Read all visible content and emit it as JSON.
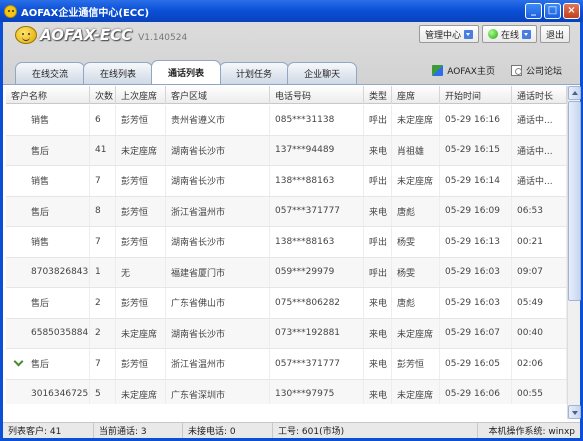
{
  "window": {
    "title": "AOFAX企业通信中心(ECC)",
    "controls": [
      "_",
      "□",
      "×"
    ]
  },
  "brand": {
    "name": "AOFAX-ECC",
    "version": "V1.140524"
  },
  "toolbar": {
    "manage_label": "管理中心",
    "status_label": "在线",
    "logout_label": "退出"
  },
  "tabs": [
    {
      "label": "在线交流",
      "active": false
    },
    {
      "label": "在线列表",
      "active": false
    },
    {
      "label": "通话列表",
      "active": true
    },
    {
      "label": "计划任务",
      "active": false
    },
    {
      "label": "企业聊天",
      "active": false
    }
  ],
  "links": {
    "home_label": "AOFAX主页",
    "forum_label": "公司论坛"
  },
  "table": {
    "columns": [
      "客户名称",
      "次数",
      "上次座席",
      "客户区域",
      "电话号码",
      "类型",
      "座席",
      "开始时间",
      "通话时长"
    ],
    "rows": [
      {
        "name": "销售",
        "count": "6",
        "last_agent": "彭芳恒",
        "region": "贵州省遵义市",
        "phone": "085***31138",
        "type": "呼出",
        "agent": "未定座席",
        "start": "05-29 16:16",
        "duration": "通话中...",
        "icon": ""
      },
      {
        "name": "售后",
        "count": "41",
        "last_agent": "未定座席",
        "region": "湖南省长沙市",
        "phone": "137***94489",
        "type": "来电",
        "agent": "肖祖雄",
        "start": "05-29 16:15",
        "duration": "通话中...",
        "icon": ""
      },
      {
        "name": "销售",
        "count": "7",
        "last_agent": "彭芳恒",
        "region": "湖南省长沙市",
        "phone": "138***88163",
        "type": "呼出",
        "agent": "未定座席",
        "start": "05-29 16:14",
        "duration": "通话中...",
        "icon": ""
      },
      {
        "name": "售后",
        "count": "8",
        "last_agent": "彭芳恒",
        "region": "浙江省温州市",
        "phone": "057***371777",
        "type": "来电",
        "agent": "唐彪",
        "start": "05-29 16:09",
        "duration": "06:53",
        "icon": ""
      },
      {
        "name": "销售",
        "count": "7",
        "last_agent": "彭芳恒",
        "region": "湖南省长沙市",
        "phone": "138***88163",
        "type": "呼出",
        "agent": "杨雯",
        "start": "05-29 16:13",
        "duration": "00:21",
        "icon": ""
      },
      {
        "name": "8703826843",
        "count": "1",
        "last_agent": "无",
        "region": "福建省厦门市",
        "phone": "059***29979",
        "type": "呼出",
        "agent": "杨雯",
        "start": "05-29 16:03",
        "duration": "09:07",
        "icon": ""
      },
      {
        "name": "售后",
        "count": "2",
        "last_agent": "彭芳恒",
        "region": "广东省佛山市",
        "phone": "075***806282",
        "type": "来电",
        "agent": "唐彪",
        "start": "05-29 16:03",
        "duration": "05:49",
        "icon": ""
      },
      {
        "name": "6585035884",
        "count": "2",
        "last_agent": "未定座席",
        "region": "湖南省长沙市",
        "phone": "073***192881",
        "type": "来电",
        "agent": "未定座席",
        "start": "05-29 16:07",
        "duration": "00:40",
        "icon": ""
      },
      {
        "name": "售后",
        "count": "7",
        "last_agent": "彭芳恒",
        "region": "浙江省温州市",
        "phone": "057***371777",
        "type": "来电",
        "agent": "彭芳恒",
        "start": "05-29 16:05",
        "duration": "02:06",
        "icon": "callin"
      },
      {
        "name": "3016346725",
        "count": "5",
        "last_agent": "未定座席",
        "region": "广东省深圳市",
        "phone": "130***97975",
        "type": "来电",
        "agent": "未定座席",
        "start": "05-29 16:06",
        "duration": "00:55",
        "icon": ""
      }
    ]
  },
  "statusbar": {
    "list_count": "列表客户: 41",
    "current_calls": "当前通话: 3",
    "missed_calls": "未接电话: 0",
    "job_no": "工号: 601(市场)",
    "os": "本机操作系统: winxp"
  },
  "colors": {
    "titlebar": "#0a4fd6",
    "tab_border": "#8fa6c6"
  }
}
